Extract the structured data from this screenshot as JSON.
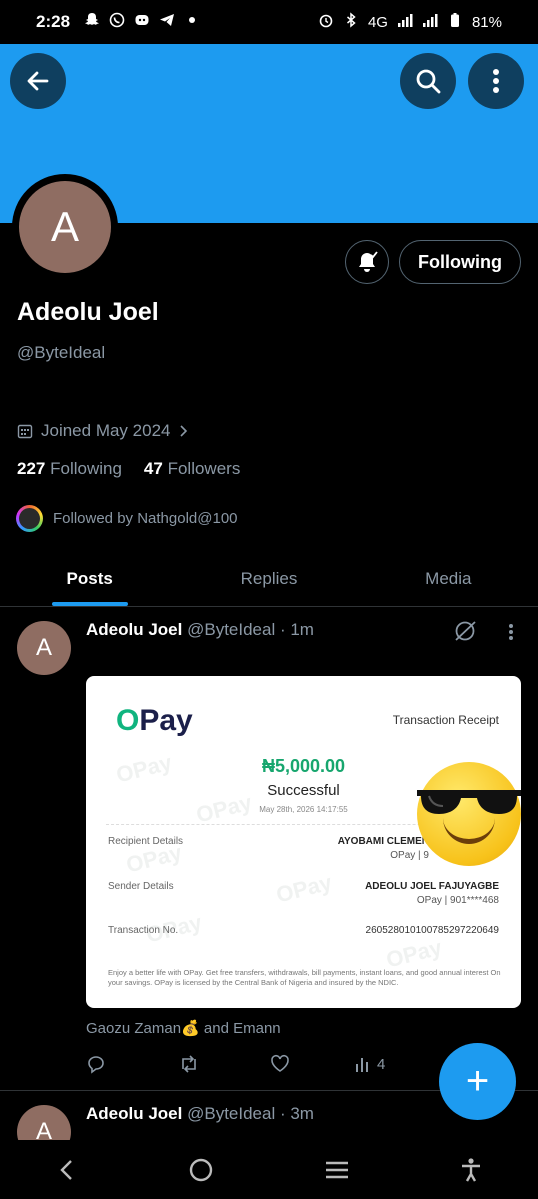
{
  "status_bar": {
    "time": "2:28",
    "network": "4G",
    "battery": "81%",
    "left_icons": [
      "snapchat-icon",
      "whatsapp-icon",
      "discord-icon",
      "telegram-icon",
      "dot-icon"
    ],
    "right_icons": [
      "alarm-icon",
      "bluetooth-icon",
      "signal-icon",
      "signal-icon",
      "battery-icon"
    ]
  },
  "header": {
    "back_icon": "arrow-left-icon",
    "search_icon": "search-icon",
    "more_icon": "more-vertical-icon",
    "banner_color": "#1d9bf0"
  },
  "profile": {
    "avatar_letter": "A",
    "name": "Adeolu Joel",
    "handle": "@ByteIdeal",
    "following_button": "Following",
    "joined": "Joined May 2024",
    "following_count": "227",
    "following_label": "Following",
    "followers_count": "47",
    "followers_label": "Followers",
    "followed_by": "Followed by Nathgold@100"
  },
  "tabs": [
    {
      "label": "Posts",
      "active": true
    },
    {
      "label": "Replies",
      "active": false
    },
    {
      "label": "Media",
      "active": false
    }
  ],
  "posts": [
    {
      "avatar_letter": "A",
      "name": "Adeolu Joel",
      "handle": "@ByteIdeal",
      "time": "· 1m",
      "receipt": {
        "logo": "OPay",
        "title": "Transaction Receipt",
        "amount": "₦5,000.00",
        "status": "Successful",
        "date": "May 28th, 2026 14:17:55",
        "recipient_label": "Recipient Details",
        "recipient_name": "AYOBAMI CLEMEN",
        "recipient_bank": "OPay | 9",
        "sender_label": "Sender Details",
        "sender_name": "ADEOLU JOEL FAJUYAGBE",
        "sender_bank": "OPay | 901****468",
        "txn_label": "Transaction No.",
        "txn_no": "260528010100785297220649",
        "footer": "Enjoy a better life with OPay. Get free transfers, withdrawals, bill payments, instant loans, and good annual interest On your savings. OPay is licensed by the Central Bank of Nigeria and insured by the NDIC."
      },
      "liked_by_prefix": "Gaozu Zaman",
      "liked_by_suffix": "and Emann",
      "views": "4"
    },
    {
      "avatar_letter": "A",
      "name": "Adeolu Joel",
      "handle": "@ByteIdeal",
      "time": "· 3m"
    }
  ],
  "fab_label": "+",
  "nav": [
    "back-nav-icon",
    "home-nav-icon",
    "recents-nav-icon",
    "accessibility-icon"
  ]
}
